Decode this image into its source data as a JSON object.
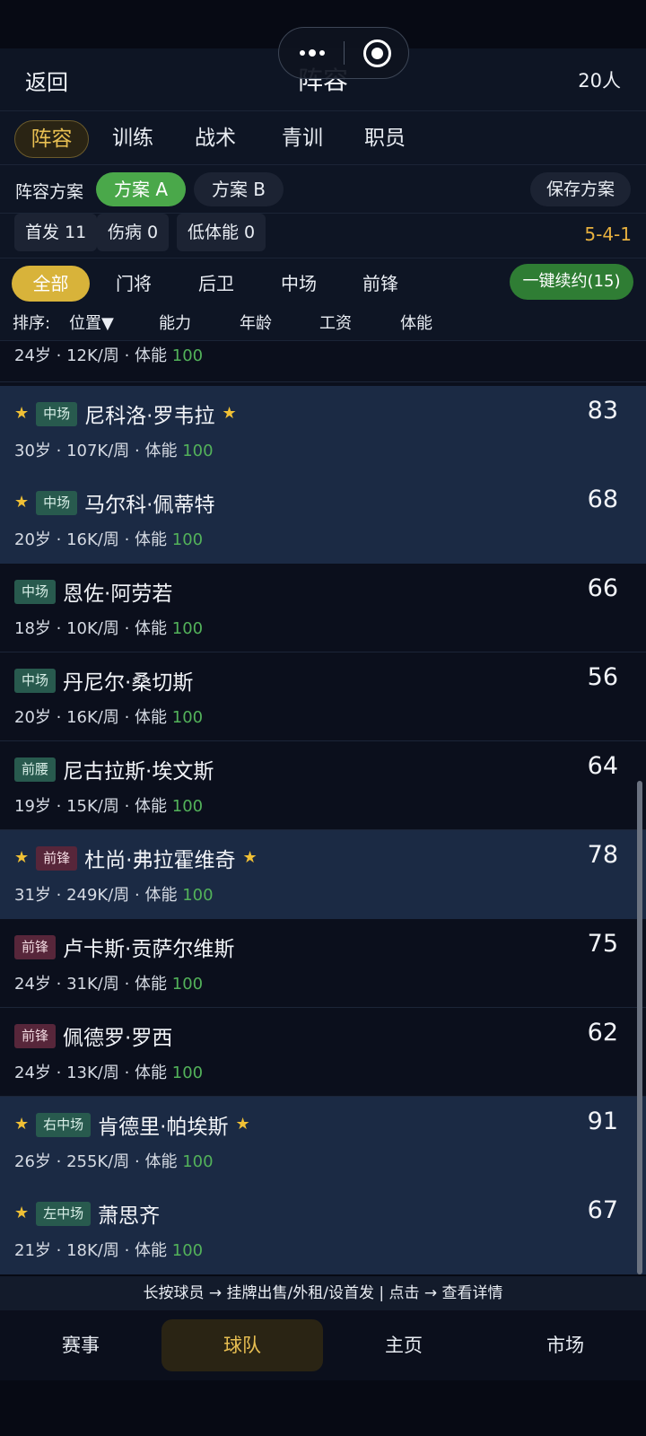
{
  "header": {
    "back_label": "返回",
    "title": "阵容",
    "player_count": "20人",
    "capsule": {
      "more_icon": "more-dots-icon",
      "close_icon": "target-close-icon"
    }
  },
  "tabs": [
    "阵容",
    "训练",
    "战术",
    "青训",
    "职员"
  ],
  "active_tab": "阵容",
  "scheme": {
    "label": "阵容方案",
    "options": [
      "方案 A",
      "方案 B"
    ],
    "selected": "方案 A",
    "save_label": "保存方案"
  },
  "stats": {
    "starters": "首发 11",
    "injured": "伤病 0",
    "low_stamina": "低体能 0",
    "formation": "5-4-1"
  },
  "filters": [
    "全部",
    "门将",
    "后卫",
    "中场",
    "前锋"
  ],
  "active_filter": "全部",
  "renew_all_label": "一键续约(15)",
  "sort": {
    "label": "排序:",
    "options": [
      "位置▼",
      "能力",
      "年龄",
      "工资",
      "体能"
    ]
  },
  "players": [
    {
      "starred": false,
      "position": "",
      "name": "",
      "rating": "",
      "age": "24岁",
      "wage": "12K/周",
      "stamina_label": "体能",
      "stamina": "100"
    },
    {
      "starred": true,
      "position": "中场",
      "name": "尼科洛·罗韦拉",
      "rating": "83",
      "age": "30岁",
      "wage": "107K/周",
      "stamina_label": "体能",
      "stamina": "100"
    },
    {
      "starred": true,
      "position": "中场",
      "name": "马尔科·佩蒂特",
      "rating": "68",
      "age": "20岁",
      "wage": "16K/周",
      "stamina_label": "体能",
      "stamina": "100"
    },
    {
      "starred": false,
      "position": "中场",
      "name": "恩佐·阿劳若",
      "rating": "66",
      "age": "18岁",
      "wage": "10K/周",
      "stamina_label": "体能",
      "stamina": "100"
    },
    {
      "starred": false,
      "position": "中场",
      "name": "丹尼尔·桑切斯",
      "rating": "56",
      "age": "20岁",
      "wage": "16K/周",
      "stamina_label": "体能",
      "stamina": "100"
    },
    {
      "starred": false,
      "position": "前腰",
      "name": "尼古拉斯·埃文斯",
      "rating": "64",
      "age": "19岁",
      "wage": "15K/周",
      "stamina_label": "体能",
      "stamina": "100"
    },
    {
      "starred": true,
      "position": "前锋",
      "name": "杜尚·弗拉霍维奇",
      "rating": "78",
      "age": "31岁",
      "wage": "249K/周",
      "stamina_label": "体能",
      "stamina": "100"
    },
    {
      "starred": false,
      "position": "前锋",
      "name": "卢卡斯·贡萨尔维斯",
      "rating": "75",
      "age": "24岁",
      "wage": "31K/周",
      "stamina_label": "体能",
      "stamina": "100"
    },
    {
      "starred": false,
      "position": "前锋",
      "name": "佩德罗·罗西",
      "rating": "62",
      "age": "24岁",
      "wage": "13K/周",
      "stamina_label": "体能",
      "stamina": "100"
    },
    {
      "starred": true,
      "position": "右中场",
      "name": "肯德里·帕埃斯",
      "rating": "91",
      "age": "26岁",
      "wage": "255K/周",
      "stamina_label": "体能",
      "stamina": "100"
    },
    {
      "starred": true,
      "position": "左中场",
      "name": "萧思齐",
      "rating": "67",
      "age": "21岁",
      "wage": "18K/周",
      "stamina_label": "体能",
      "stamina": "100"
    }
  ],
  "hint": "长按球员 → 挂牌出售/外租/设首发 | 点击 → 查看详情",
  "bottom_nav": [
    "赛事",
    "球队",
    "主页",
    "市场"
  ],
  "active_nav": "球队",
  "colors": {
    "accent_gold": "#e8bf52",
    "green": "#4aa84a",
    "stamina_green": "#53b25a",
    "star_row_bg": "#1b2a44"
  }
}
